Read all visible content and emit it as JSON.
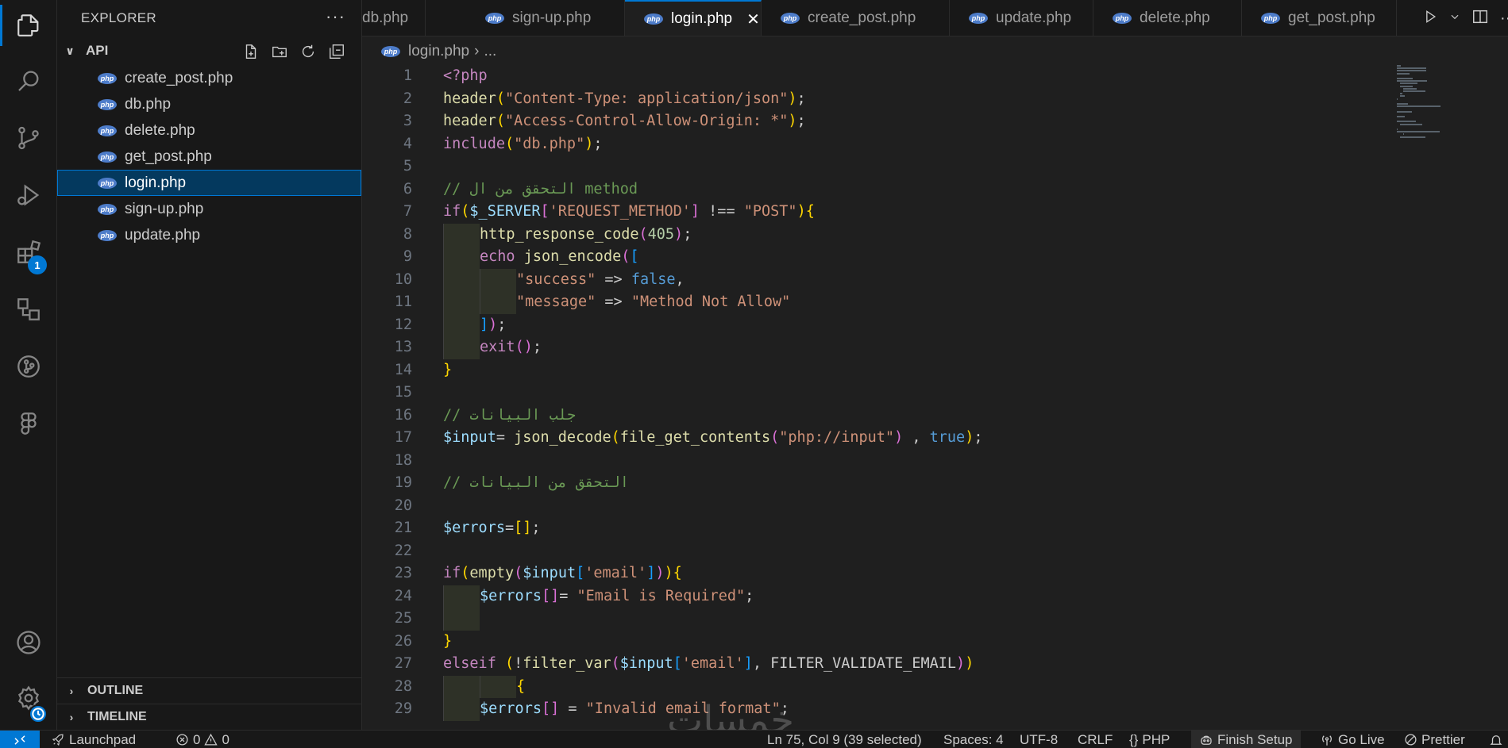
{
  "sidebar": {
    "title": "EXPLORER",
    "more": "···",
    "folder": "API",
    "files": [
      {
        "name": "create_post.php"
      },
      {
        "name": "db.php"
      },
      {
        "name": "delete.php"
      },
      {
        "name": "get_post.php"
      },
      {
        "name": "login.php",
        "selected": true
      },
      {
        "name": "sign-up.php"
      },
      {
        "name": "update.php"
      }
    ],
    "outline": "OUTLINE",
    "timeline": "TIMELINE"
  },
  "activity": {
    "extensions_badge": "1"
  },
  "tabs": [
    {
      "label": "db.php"
    },
    {
      "label": "sign-up.php"
    },
    {
      "label": "login.php",
      "active": true
    },
    {
      "label": "create_post.php"
    },
    {
      "label": "update.php"
    },
    {
      "label": "delete.php"
    },
    {
      "label": "get_post.php"
    }
  ],
  "tab_close": "✕",
  "file_icon_text": "php",
  "breadcrumb": {
    "file": "login.php",
    "sep": "›",
    "rest": "..."
  },
  "code_lines": [
    {
      "n": "1",
      "t": [
        [
          "k",
          "<?php"
        ]
      ]
    },
    {
      "n": "2",
      "t": [
        [
          "f",
          "header"
        ],
        [
          "br1",
          "("
        ],
        [
          "s",
          "\"Content-Type: application/json\""
        ],
        [
          "br1",
          ")"
        ],
        [
          "",
          ";"
        ]
      ]
    },
    {
      "n": "3",
      "t": [
        [
          "f",
          "header"
        ],
        [
          "br1",
          "("
        ],
        [
          "s",
          "\"Access-Control-Allow-Origin: *\""
        ],
        [
          "br1",
          ")"
        ],
        [
          "",
          ";"
        ]
      ]
    },
    {
      "n": "4",
      "t": [
        [
          "k",
          "include"
        ],
        [
          "br1",
          "("
        ],
        [
          "s",
          "\"db.php\""
        ],
        [
          "br1",
          ")"
        ],
        [
          "",
          ";"
        ]
      ]
    },
    {
      "n": "5",
      "t": []
    },
    {
      "n": "6",
      "t": [
        [
          "c",
          "// التحقق من ال method"
        ]
      ]
    },
    {
      "n": "7",
      "t": [
        [
          "k",
          "if"
        ],
        [
          "br1",
          "("
        ],
        [
          "v",
          "$_SERVER"
        ],
        [
          "br2",
          "["
        ],
        [
          "s",
          "'REQUEST_METHOD'"
        ],
        [
          "br2",
          "]"
        ],
        [
          "",
          " !== "
        ],
        [
          "s",
          "\"POST\""
        ],
        [
          "br1",
          ")"
        ],
        [
          "br1",
          "{"
        ]
      ]
    },
    {
      "n": "8",
      "g": 1,
      "t": [
        [
          "f",
          "http_response_code"
        ],
        [
          "br2",
          "("
        ],
        [
          "n",
          "405"
        ],
        [
          "br2",
          ")"
        ],
        [
          "",
          ";"
        ]
      ]
    },
    {
      "n": "9",
      "g": 1,
      "t": [
        [
          "k",
          "echo"
        ],
        [
          "",
          " "
        ],
        [
          "f",
          "json_encode"
        ],
        [
          "br2",
          "("
        ],
        [
          "br3",
          "["
        ]
      ]
    },
    {
      "n": "10",
      "g": 2,
      "t": [
        [
          "s",
          "\"success\""
        ],
        [
          "",
          " => "
        ],
        [
          "b",
          "false"
        ],
        [
          "",
          ","
        ]
      ]
    },
    {
      "n": "11",
      "g": 2,
      "t": [
        [
          "s",
          "\"message\""
        ],
        [
          "",
          " => "
        ],
        [
          "s",
          "\"Method Not Allow\""
        ]
      ]
    },
    {
      "n": "12",
      "g": 1,
      "t": [
        [
          "br3",
          "]"
        ],
        [
          "br2",
          ")"
        ],
        [
          "",
          ";"
        ]
      ]
    },
    {
      "n": "13",
      "g": 1,
      "t": [
        [
          "k",
          "exit"
        ],
        [
          "br2",
          "()"
        ],
        [
          "",
          ";"
        ]
      ]
    },
    {
      "n": "14",
      "t": [
        [
          "br1",
          "}"
        ]
      ]
    },
    {
      "n": "15",
      "t": []
    },
    {
      "n": "16",
      "t": [
        [
          "c",
          "// جلب البيانات"
        ]
      ]
    },
    {
      "n": "17",
      "t": [
        [
          "v",
          "$input"
        ],
        [
          "",
          "= "
        ],
        [
          "f",
          "json_decode"
        ],
        [
          "br1",
          "("
        ],
        [
          "f",
          "file_get_contents"
        ],
        [
          "br2",
          "("
        ],
        [
          "s",
          "\"php://input\""
        ],
        [
          "br2",
          ")"
        ],
        [
          "",
          " , "
        ],
        [
          "b",
          "true"
        ],
        [
          "br1",
          ")"
        ],
        [
          "",
          ";"
        ]
      ]
    },
    {
      "n": "18",
      "t": []
    },
    {
      "n": "19",
      "t": [
        [
          "c",
          "// التحقق من البيانات"
        ]
      ]
    },
    {
      "n": "20",
      "t": []
    },
    {
      "n": "21",
      "t": [
        [
          "v",
          "$errors"
        ],
        [
          "",
          "="
        ],
        [
          "br1",
          "[]"
        ],
        [
          "",
          ";"
        ]
      ]
    },
    {
      "n": "22",
      "t": []
    },
    {
      "n": "23",
      "t": [
        [
          "k",
          "if"
        ],
        [
          "br1",
          "("
        ],
        [
          "f",
          "empty"
        ],
        [
          "br2",
          "("
        ],
        [
          "v",
          "$input"
        ],
        [
          "br3",
          "["
        ],
        [
          "s",
          "'email'"
        ],
        [
          "br3",
          "]"
        ],
        [
          "br2",
          ")"
        ],
        [
          "br1",
          ")"
        ],
        [
          "br1",
          "{"
        ]
      ]
    },
    {
      "n": "24",
      "g": 1,
      "t": [
        [
          "v",
          "$errors"
        ],
        [
          "br2",
          "[]"
        ],
        [
          "",
          "= "
        ],
        [
          "s",
          "\"Email is Required\""
        ],
        [
          "",
          ";"
        ]
      ]
    },
    {
      "n": "25",
      "g": 1,
      "t": []
    },
    {
      "n": "26",
      "t": [
        [
          "br1",
          "}"
        ]
      ]
    },
    {
      "n": "27",
      "t": [
        [
          "k",
          "elseif"
        ],
        [
          "",
          " "
        ],
        [
          "br1",
          "("
        ],
        [
          "",
          "!"
        ],
        [
          "f",
          "filter_var"
        ],
        [
          "br2",
          "("
        ],
        [
          "v",
          "$input"
        ],
        [
          "br3",
          "["
        ],
        [
          "s",
          "'email'"
        ],
        [
          "br3",
          "]"
        ],
        [
          "",
          ", FILTER_VALIDATE_EMAIL"
        ],
        [
          "br2",
          ")"
        ],
        [
          "br1",
          ")"
        ]
      ]
    },
    {
      "n": "28",
      "g": 2,
      "t": [
        [
          "br1",
          "{"
        ]
      ]
    },
    {
      "n": "29",
      "g": 1,
      "t": [
        [
          "v",
          "$errors"
        ],
        [
          "br2",
          "[]"
        ],
        [
          "",
          " = "
        ],
        [
          "s",
          "\"Invalid email format\""
        ],
        [
          "",
          ";"
        ]
      ]
    }
  ],
  "watermark": "خمسات",
  "statusbar": {
    "launchpad": "Launchpad",
    "errors": "0",
    "warnings": "0",
    "position": "Ln 75, Col 9 (39 selected)",
    "spaces": "Spaces: 4",
    "encoding": "UTF-8",
    "eol": "CRLF",
    "lang_braces": "{}",
    "language": "PHP",
    "finish_setup": "Finish Setup",
    "go_live": "Go Live",
    "prettier": "Prettier"
  },
  "colors": {
    "accent": "#0078d4",
    "keyword": "#c586c0",
    "function": "#dcdcaa",
    "string": "#ce9178",
    "variable": "#9cdcfe",
    "comment": "#6a9955",
    "number": "#b5cea8"
  }
}
